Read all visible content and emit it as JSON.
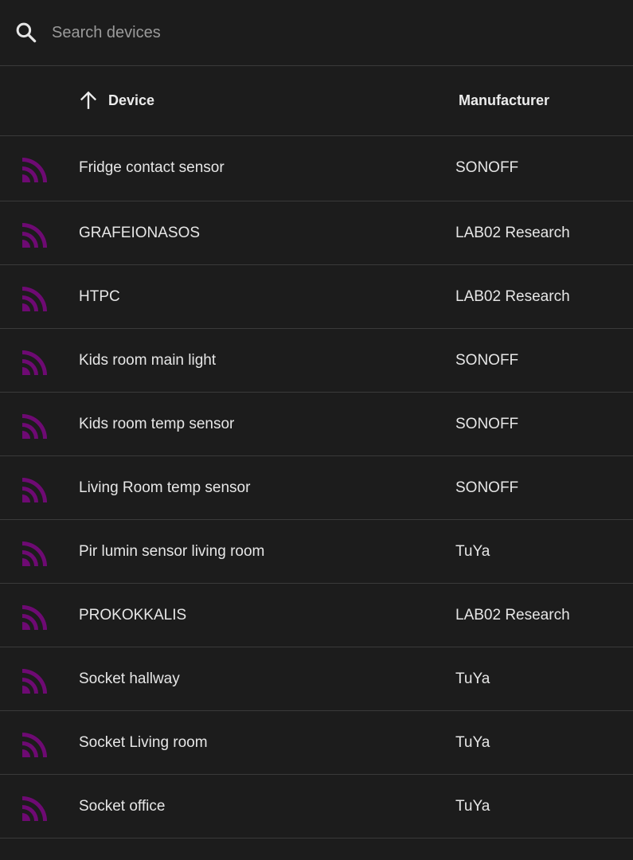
{
  "search": {
    "placeholder": "Search devices",
    "value": ""
  },
  "table": {
    "sort": {
      "column": "Device",
      "direction": "ascending"
    },
    "headers": {
      "device": "Device",
      "manufacturer": "Manufacturer"
    },
    "rows": [
      {
        "device": "Fridge contact sensor",
        "manufacturer": "SONOFF",
        "icon": "zigbee-icon"
      },
      {
        "device": "GRAFEIONASOS",
        "manufacturer": "LAB02 Research",
        "icon": "zigbee-icon"
      },
      {
        "device": "HTPC",
        "manufacturer": "LAB02 Research",
        "icon": "zigbee-icon"
      },
      {
        "device": "Kids room main light",
        "manufacturer": "SONOFF",
        "icon": "zigbee-icon"
      },
      {
        "device": "Kids room temp sensor",
        "manufacturer": "SONOFF",
        "icon": "zigbee-icon"
      },
      {
        "device": "Living Room temp sensor",
        "manufacturer": "SONOFF",
        "icon": "zigbee-icon"
      },
      {
        "device": "Pir lumin sensor living room",
        "manufacturer": "TuYa",
        "icon": "zigbee-icon"
      },
      {
        "device": "PROKOKKALIS",
        "manufacturer": "LAB02 Research",
        "icon": "zigbee-icon"
      },
      {
        "device": "Socket hallway",
        "manufacturer": "TuYa",
        "icon": "zigbee-icon"
      },
      {
        "device": "Socket Living room",
        "manufacturer": "TuYa",
        "icon": "zigbee-icon"
      },
      {
        "device": "Socket office",
        "manufacturer": "TuYa",
        "icon": "zigbee-icon"
      }
    ]
  },
  "colors": {
    "background": "#1c1c1c",
    "divider": "#3a3a3a",
    "icon_purple": "#6e0a73",
    "text": "#e6e6e6",
    "placeholder": "#9a9a9a"
  }
}
